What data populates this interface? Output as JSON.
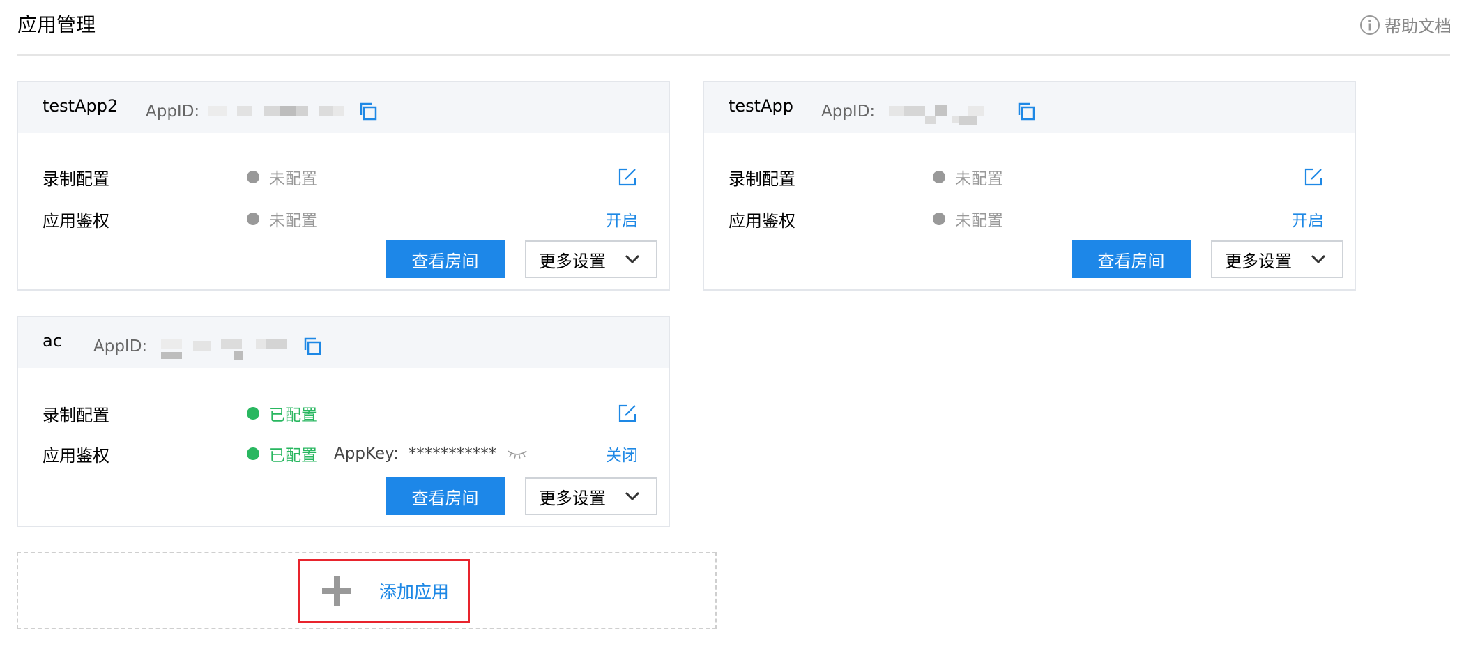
{
  "header": {
    "title": "应用管理",
    "help_label": "帮助文档"
  },
  "labels": {
    "appid": "AppID:",
    "record_config": "录制配置",
    "app_auth": "应用鉴权",
    "view_rooms": "查看房间",
    "more_settings": "更多设置",
    "appkey_label": "AppKey:"
  },
  "apps": [
    {
      "name": "testApp2",
      "record_status": "未配置",
      "auth_status": "未配置",
      "auth_action": "开启"
    },
    {
      "name": "testApp",
      "record_status": "未配置",
      "auth_status": "未配置",
      "auth_action": "开启"
    },
    {
      "name": "ac",
      "record_status": "已配置",
      "auth_status": "已配置",
      "auth_action": "关闭",
      "appkey_value": "***********"
    }
  ],
  "add_app": {
    "label": "添加应用"
  },
  "colors": {
    "accent": "#1d87e8",
    "configured": "#29b760",
    "unconfigured": "#999999",
    "highlight": "#e8242d"
  }
}
